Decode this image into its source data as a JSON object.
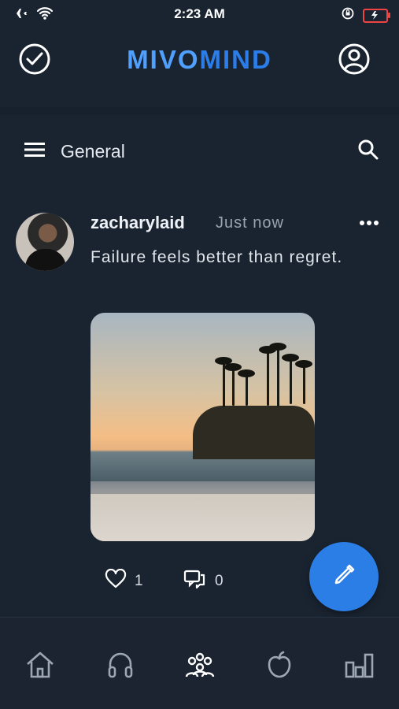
{
  "status_bar": {
    "time": "2:23 AM"
  },
  "app_bar": {
    "brand_prefix": "MIVO",
    "brand_suffix": "MIND"
  },
  "subheader": {
    "title": "General"
  },
  "post": {
    "username": "zacharylaid",
    "timestamp": "Just now",
    "text": "Failure feels better than regret.",
    "likes": "1",
    "comments": "0"
  },
  "colors": {
    "background": "#1a2431",
    "accent": "#2a7ee6",
    "brand_light": "#4fa0ff",
    "brand_dark": "#2b7de9"
  },
  "icons": {
    "status_left": [
      "airplane-icon",
      "wifi-icon"
    ],
    "status_right": [
      "orientation-lock-icon",
      "battery-icon"
    ],
    "top_left": "check-circle-icon",
    "top_right": "profile-icon",
    "menu": "menu-icon",
    "search": "search-icon",
    "more": "more-icon",
    "like": "heart-icon",
    "comment": "comment-icon",
    "fab": "pencil-icon",
    "bottom_nav": [
      "home-icon",
      "headphones-icon",
      "community-icon",
      "apple-icon",
      "stats-icon"
    ]
  }
}
